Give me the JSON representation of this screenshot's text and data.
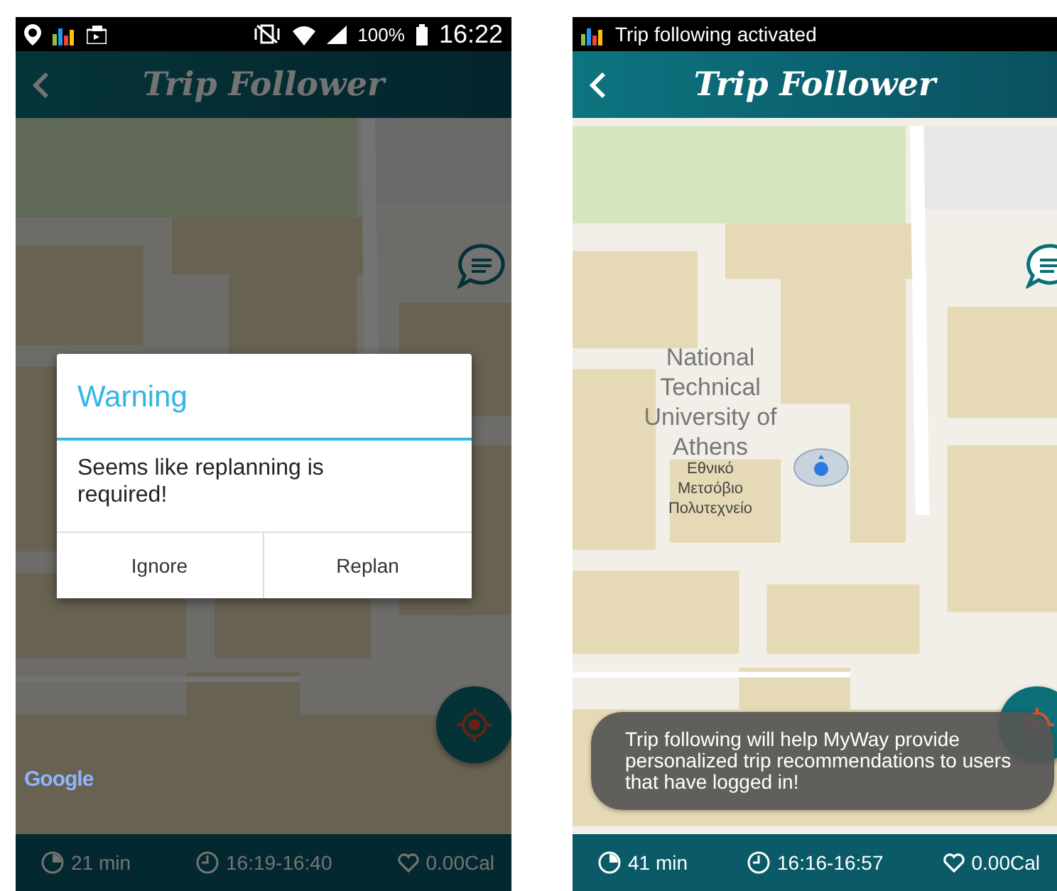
{
  "screens": [
    {
      "status_bar": {
        "kind": "system",
        "battery": "100%",
        "time": "16:22"
      },
      "header": {
        "title": "Trip Follower"
      },
      "dimmed": true,
      "map": {
        "google_logo": "Google"
      },
      "dialog": {
        "title": "Warning",
        "message": "Seems like replanning is required!",
        "buttons": [
          "Ignore",
          "Replan"
        ]
      },
      "bottom_bar": {
        "duration": "21 min",
        "time_range": "16:19-16:40",
        "calories": "0.00Cal"
      }
    },
    {
      "status_bar": {
        "kind": "notification",
        "text": "Trip following activated"
      },
      "header": {
        "title": "Trip Follower"
      },
      "dimmed": false,
      "map": {
        "place_label": "National Technical University of Athens",
        "place_label_local": "Εθνικό Μετσόβιο Πολυτεχνείο"
      },
      "toast": "Trip following will help MyWay provide personalized trip recommendations to users that have logged in!",
      "bottom_bar": {
        "duration": "41 min",
        "time_range": "16:16-16:57",
        "calories": "0.00Cal"
      }
    }
  ]
}
